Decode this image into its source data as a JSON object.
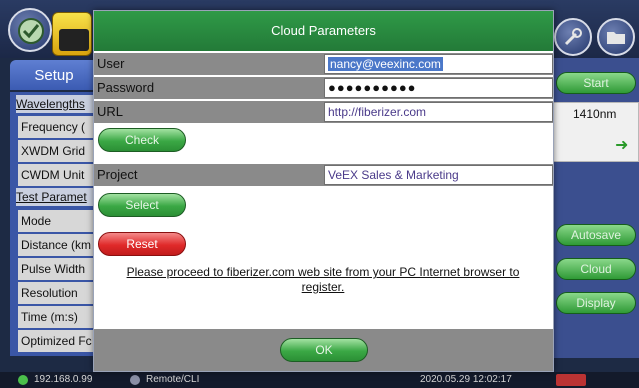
{
  "setup_tab": "Setup",
  "sidebar": {
    "items": [
      "Wavelengths",
      "Frequency (",
      "XWDM Grid",
      "CWDM Unit",
      "Test Paramet",
      "Mode",
      "Distance (km",
      "Pulse Width",
      "Resolution",
      "Time (m:s)",
      "Optimized Fc"
    ]
  },
  "right_panel": {
    "start": "Start",
    "wavelength": "1410nm",
    "autosave": "Autosave",
    "cloud": "Cloud",
    "display": "Display"
  },
  "dialog": {
    "title": "Cloud Parameters",
    "user_label": "User",
    "user_value": "nancy@veexinc.com",
    "password_label": "Password",
    "password_value": "●●●●●●●●●●",
    "url_label": "URL",
    "url_value": "http://fiberizer.com",
    "check_button": "Check",
    "project_label": "Project",
    "project_value": "VeEX Sales & Marketing",
    "select_button": "Select",
    "reset_button": "Reset",
    "notice": "Please proceed to fiberizer.com web site from your PC Internet browser to register.",
    "ok_button": "OK"
  },
  "status": {
    "ip": "192.168.0.99",
    "remote": "Remote/CLI",
    "datetime": "2020.05.29  12:02:17"
  },
  "colors": {
    "title_green": "#2f9a47",
    "button_green": "#3ba845",
    "button_red": "#e02a2a",
    "selection_blue": "#4b78c9"
  }
}
